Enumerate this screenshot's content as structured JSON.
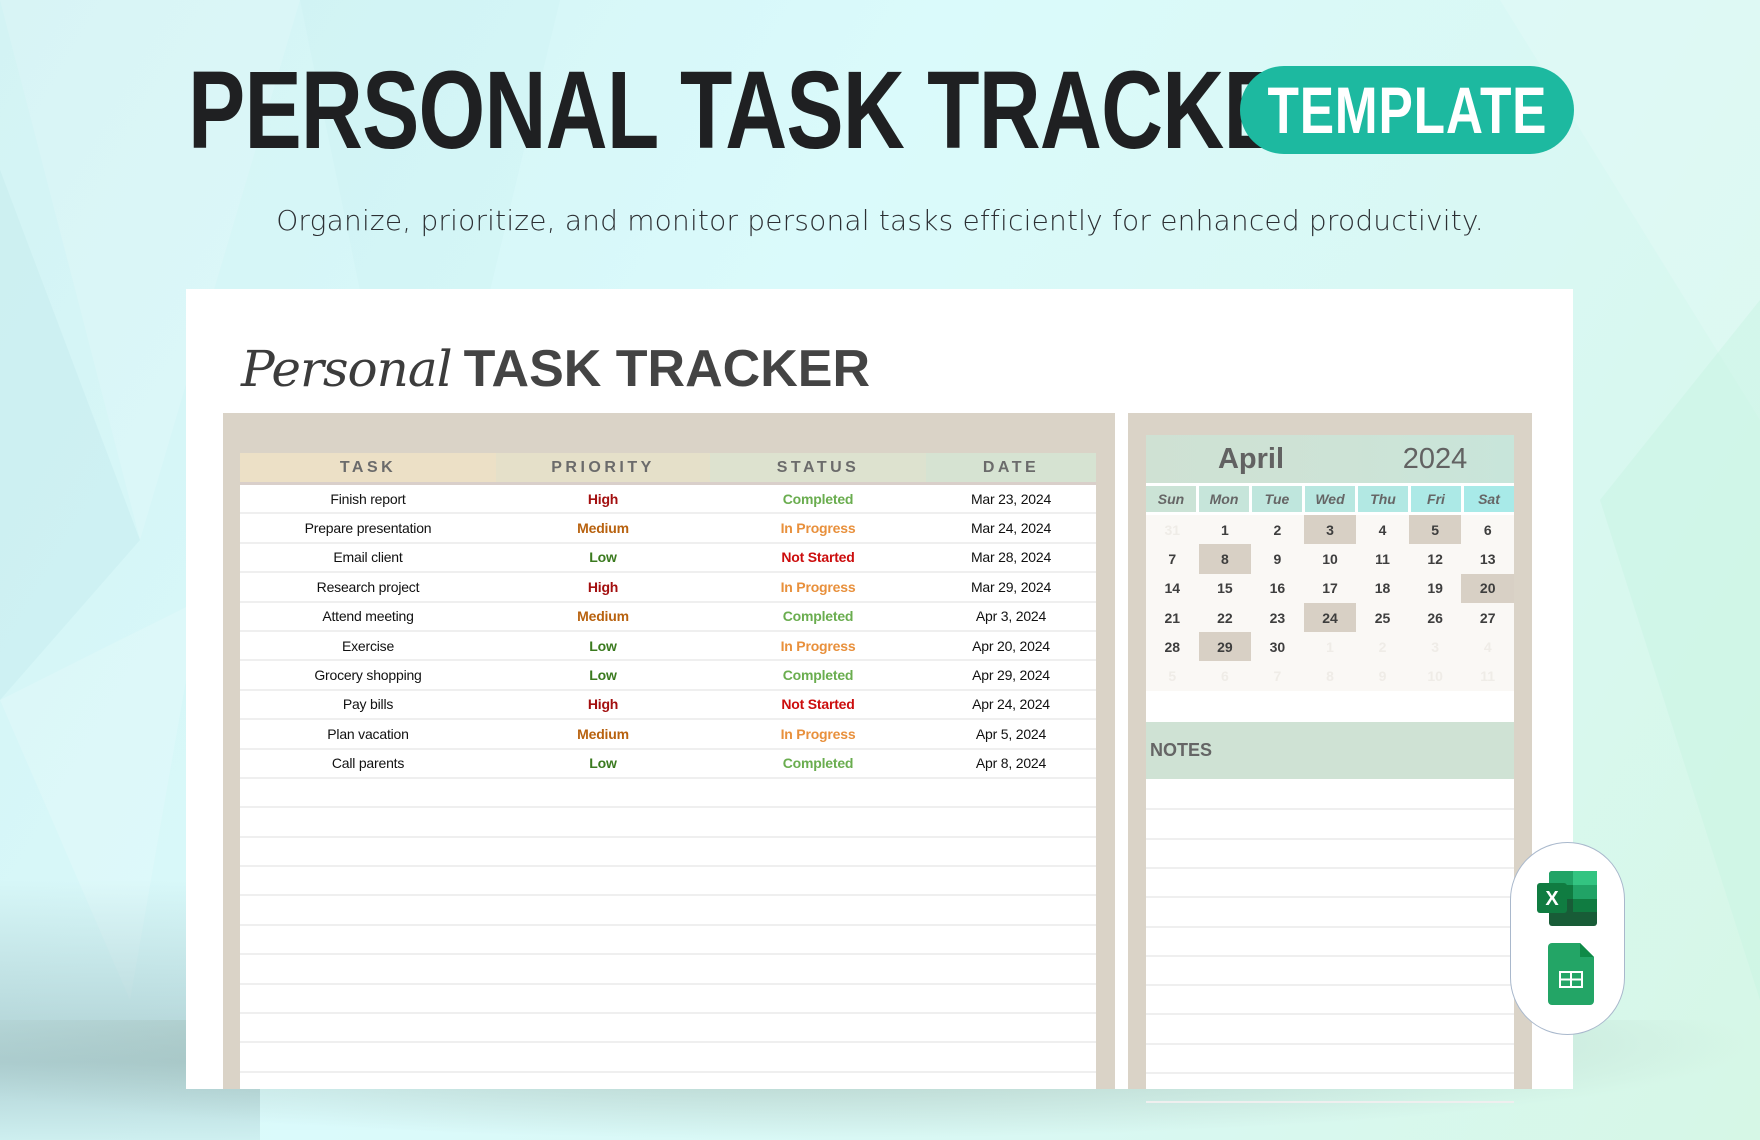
{
  "banner": {
    "headline": "PERSONAL TASK TRACKER",
    "badge": "TEMPLATE",
    "subtitle": "Organize, prioritize, and monitor personal tasks efficiently for enhanced productivity."
  },
  "sheet": {
    "title_script": "Personal",
    "title_bold": "TASK TRACKER",
    "columns": [
      "TASK",
      "PRIORITY",
      "STATUS",
      "DATE"
    ],
    "rows": [
      {
        "task": "Finish report",
        "priority": "High",
        "status": "Completed",
        "date": "Mar 23, 2024"
      },
      {
        "task": "Prepare presentation",
        "priority": "Medium",
        "status": "In Progress",
        "date": "Mar 24, 2024"
      },
      {
        "task": "Email client",
        "priority": "Low",
        "status": "Not Started",
        "date": "Mar 28, 2024"
      },
      {
        "task": "Research project",
        "priority": "High",
        "status": "In Progress",
        "date": "Mar 29, 2024"
      },
      {
        "task": "Attend meeting",
        "priority": "Medium",
        "status": "Completed",
        "date": "Apr 3, 2024"
      },
      {
        "task": "Exercise",
        "priority": "Low",
        "status": "In Progress",
        "date": "Apr 20, 2024"
      },
      {
        "task": "Grocery shopping",
        "priority": "Low",
        "status": "Completed",
        "date": "Apr 29, 2024"
      },
      {
        "task": "Pay bills",
        "priority": "High",
        "status": "Not Started",
        "date": "Apr 24, 2024"
      },
      {
        "task": "Plan vacation",
        "priority": "Medium",
        "status": "In Progress",
        "date": "Apr 5, 2024"
      },
      {
        "task": "Call parents",
        "priority": "Low",
        "status": "Completed",
        "date": "Apr 8, 2024"
      }
    ],
    "empty_rows": 10
  },
  "calendar": {
    "month": "April",
    "year": "2024",
    "weekdays": [
      "Sun",
      "Mon",
      "Tue",
      "Wed",
      "Thu",
      "Fri",
      "Sat"
    ],
    "weekday_colors": [
      "#cbe3d6",
      "#c6e5da",
      "#bfe6dd",
      "#b8e7e0",
      "#b2e8e3",
      "#ace9e6",
      "#a8eae8"
    ],
    "days": [
      {
        "d": "31",
        "other": true
      },
      {
        "d": "1"
      },
      {
        "d": "2"
      },
      {
        "d": "3",
        "hl": true
      },
      {
        "d": "4"
      },
      {
        "d": "5",
        "hl": true
      },
      {
        "d": "6"
      },
      {
        "d": "7"
      },
      {
        "d": "8",
        "hl": true
      },
      {
        "d": "9"
      },
      {
        "d": "10"
      },
      {
        "d": "11"
      },
      {
        "d": "12"
      },
      {
        "d": "13"
      },
      {
        "d": "14"
      },
      {
        "d": "15"
      },
      {
        "d": "16"
      },
      {
        "d": "17"
      },
      {
        "d": "18"
      },
      {
        "d": "19"
      },
      {
        "d": "20",
        "hl": true
      },
      {
        "d": "21"
      },
      {
        "d": "22"
      },
      {
        "d": "23"
      },
      {
        "d": "24",
        "hl": true
      },
      {
        "d": "25"
      },
      {
        "d": "26"
      },
      {
        "d": "27"
      },
      {
        "d": "28"
      },
      {
        "d": "29",
        "hl": true
      },
      {
        "d": "30"
      },
      {
        "d": "1",
        "other": true
      },
      {
        "d": "2",
        "other": true
      },
      {
        "d": "3",
        "other": true
      },
      {
        "d": "4",
        "other": true
      },
      {
        "d": "5",
        "other": true
      },
      {
        "d": "6",
        "other": true
      },
      {
        "d": "7",
        "other": true
      },
      {
        "d": "8",
        "other": true
      },
      {
        "d": "9",
        "other": true
      },
      {
        "d": "10",
        "other": true
      },
      {
        "d": "11",
        "other": true
      }
    ],
    "notes_label": "NOTES"
  },
  "apps": {
    "excel_letter": "X",
    "icons": [
      "excel-icon",
      "google-sheets-icon"
    ]
  },
  "colors": {
    "accent": "#1db9a0",
    "panel": "#dad3c7",
    "priority_high": "#a30f0f",
    "priority_medium": "#b8620f",
    "priority_low": "#3b7a1f",
    "status_completed": "#6aad4f",
    "status_in_progress": "#e8903c",
    "status_not_started": "#cc0d0d"
  }
}
